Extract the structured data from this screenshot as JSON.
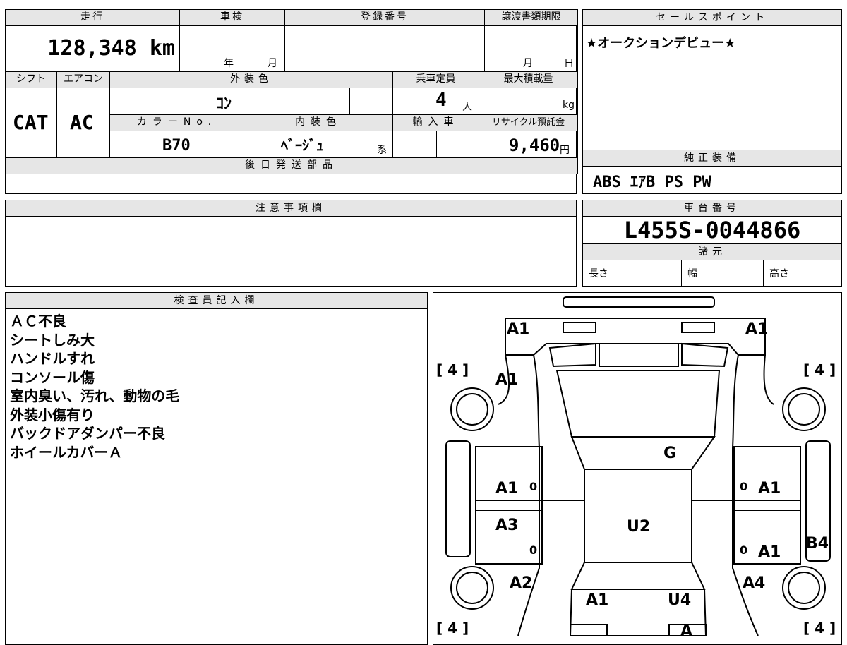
{
  "top_table": {
    "mileage_header": "走行",
    "mileage_value": "128,348 km",
    "shaken_header": "車検",
    "shaken_year": "年",
    "shaken_month": "月",
    "reg_header": "登録番号",
    "transfer_header": "譲渡書類期限",
    "transfer_month": "月",
    "transfer_day": "日",
    "shift_header": "シフト",
    "shift_value": "CAT",
    "ac_header": "エアコン",
    "ac_value": "AC",
    "exterior_header": "外装色",
    "exterior_value": "ｺﾝ",
    "capacity_header": "乗車定員",
    "capacity_value": "4",
    "capacity_unit": "人",
    "maxload_header": "最大積載量",
    "maxload_unit": "kg",
    "color_no_header": "カラーNo.",
    "color_no_value": "B70",
    "interior_header": "内装色",
    "interior_value": "ﾍﾞｰｼﾞｭ",
    "interior_suffix": "系",
    "import_header": "輸入車",
    "recycle_header": "リサイクル預託金",
    "recycle_value": "9,460",
    "recycle_unit": "円",
    "later_parts_header": "後日発送部品"
  },
  "sales_point": {
    "header": "セールスポイント",
    "text": "★オークションデビュー★"
  },
  "equipment": {
    "header": "純正装備",
    "text": "ABS ｴｱB PS PW"
  },
  "notes": {
    "header": "注意事項欄"
  },
  "chassis": {
    "header": "車台番号",
    "value": "L455S-0044866",
    "spec_header": "諸元",
    "length": "長さ",
    "width": "幅",
    "height": "高さ"
  },
  "inspector": {
    "header": "検査員記入欄",
    "lines": [
      "ＡＣ不良",
      "シートしみ大",
      "ハンドルすれ",
      "コンソール傷",
      "室内臭い、汚れ、動物の毛",
      "外装小傷有り",
      "バックドアダンパー不良",
      "ホイールカバーＡ"
    ]
  },
  "diagram": {
    "front_left": "A1",
    "front_right": "A1",
    "tire_fl": "[ 4 ]",
    "tire_fr": "[ 4 ]",
    "tire_rl": "[ 4 ]",
    "tire_rr": "[ 4 ]",
    "fender_left": "A1",
    "windshield": "G",
    "door_fl": "A1",
    "door_fr": "A1",
    "door_rl": "A3",
    "door_rr": "A1",
    "zero_1": "0",
    "zero_2": "0",
    "zero_3": "0",
    "zero_4": "0",
    "roof": "U2",
    "step_right": "B4",
    "quarter_left": "A2",
    "quarter_right": "A4",
    "rear_left": "A1",
    "rear_right": "U4",
    "rear_bottom": "A"
  }
}
